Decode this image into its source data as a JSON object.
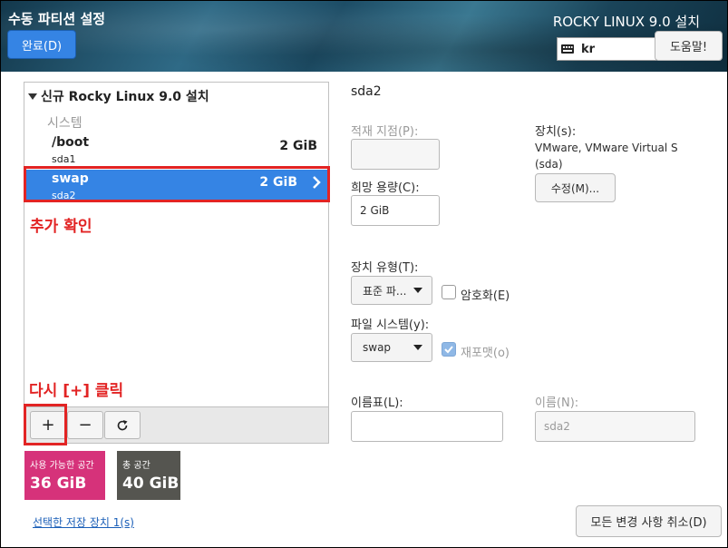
{
  "header": {
    "title": "수동 파티션 설정",
    "done_label": "완료(D)",
    "product_title": "ROCKY LINUX 9.0 설치",
    "keyboard_layout": "kr",
    "help_label": "도움말!"
  },
  "partition_list": {
    "group_title": "신규 Rocky Linux 9.0 설치",
    "section_label": "시스템",
    "items": [
      {
        "name": "/boot",
        "device": "sda1",
        "size": "2 GiB"
      },
      {
        "name": "swap",
        "device": "sda2",
        "size": "2 GiB"
      }
    ]
  },
  "annotations": {
    "swap_note": "추가 확인",
    "add_note": "다시 [+] 클릭"
  },
  "toolbar": {
    "add_symbol": "+",
    "remove_symbol": "−"
  },
  "space": {
    "available_label": "사용 가능한 공간",
    "available_value": "36 GiB",
    "total_label": "총 공간",
    "total_value": "40 GiB"
  },
  "selected_devices_link": "선택한 저장 장치 1(s)",
  "details": {
    "title": "sda2",
    "mount_point_label": "적재 지점(P):",
    "mount_point_value": "",
    "desired_capacity_label": "희망 용량(C):",
    "desired_capacity_value": "2 GiB",
    "device_label": "장치(s):",
    "device_desc_line1": "VMware, VMware Virtual S",
    "device_desc_line2": "(sda)",
    "modify_label": "수정(M)...",
    "device_type_label": "장치 유형(T):",
    "device_type_value": "표준 파...",
    "encrypt_label": "암호화(E)",
    "filesystem_label": "파일 시스템(y):",
    "filesystem_value": "swap",
    "reformat_label": "재포맷(o)",
    "label_label": "이름표(L):",
    "label_value": "",
    "name_label": "이름(N):",
    "name_value": "sda2"
  },
  "reset_label": "모든 변경 사항 취소(D)"
}
